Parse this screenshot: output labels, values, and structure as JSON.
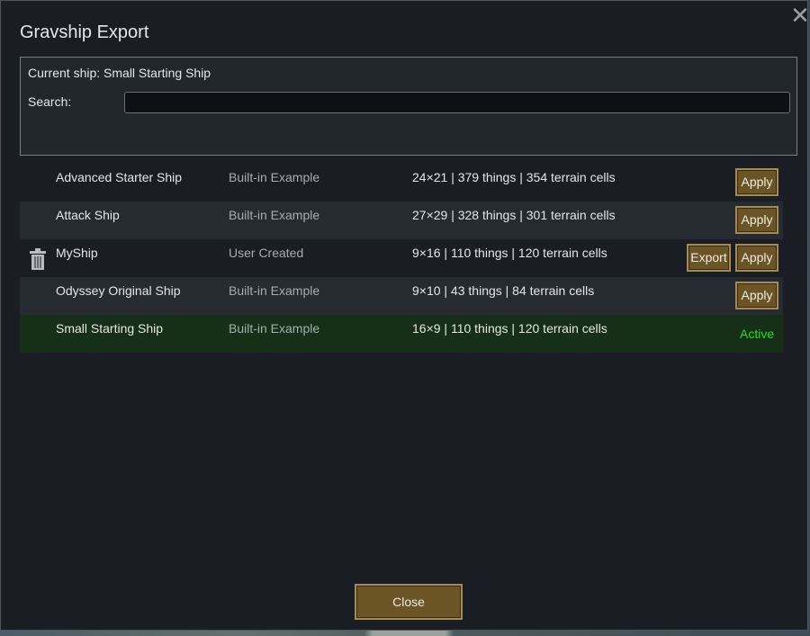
{
  "window": {
    "title": "Gravship Export",
    "close_icon": "close-icon"
  },
  "header": {
    "current_ship": "Current ship: Small Starting Ship",
    "search_label": "Search:",
    "search_value": "",
    "search_placeholder": ""
  },
  "ships": [
    {
      "name": "Advanced Starter Ship",
      "type": "Built-in Example",
      "stats": "24×21 | 379 things | 354 terrain cells",
      "apply_label": "Apply"
    },
    {
      "name": "Attack Ship",
      "type": "Built-in Example",
      "stats": "27×29 | 328 things | 301 terrain cells",
      "apply_label": "Apply"
    },
    {
      "name": "MyShip",
      "type": "User Created",
      "stats": "9×16 | 110 things | 120 terrain cells",
      "export_label": "Export",
      "apply_label": "Apply",
      "delete_icon": "trash-icon"
    },
    {
      "name": "Odyssey Original Ship",
      "type": "Built-in Example",
      "stats": "9×10 | 43 things | 84 terrain cells",
      "apply_label": "Apply"
    },
    {
      "name": "Small Starting Ship",
      "type": "Built-in Example",
      "stats": "16×9 | 110 things | 120 terrain cells",
      "status": "Active"
    }
  ],
  "footer": {
    "close_label": "Close"
  },
  "colors": {
    "background": "#1a1e24",
    "button": "#6b5425",
    "button_border": "#a48a53",
    "active_row": "#163018",
    "active_text": "#22dd22"
  }
}
